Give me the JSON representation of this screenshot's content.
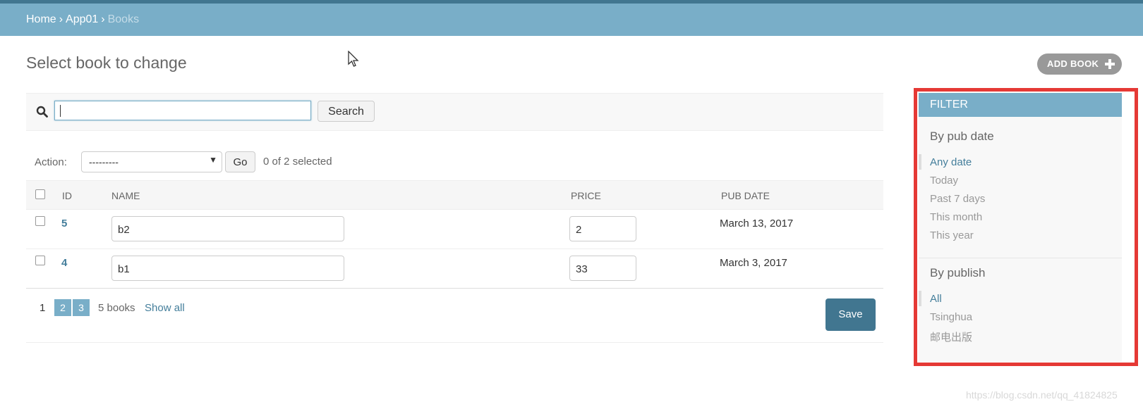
{
  "breadcrumbs": {
    "home": "Home",
    "sep": "›",
    "app": "App01",
    "current": "Books"
  },
  "page": {
    "title": "Select book to change",
    "add_button": "ADD BOOK"
  },
  "search": {
    "value": "",
    "button": "Search"
  },
  "actions": {
    "label": "Action:",
    "select_value": "---------",
    "go": "Go",
    "selected": "0 of 2 selected"
  },
  "table": {
    "headers": {
      "id": "ID",
      "name": "NAME",
      "price": "PRICE",
      "pub_date": "PUB DATE"
    },
    "rows": [
      {
        "id": "5",
        "name": "b2",
        "price": "2",
        "pub_date": "March 13, 2017"
      },
      {
        "id": "4",
        "name": "b1",
        "price": "33",
        "pub_date": "March 3, 2017"
      }
    ]
  },
  "pagination": {
    "current": "1",
    "page2": "2",
    "page3": "3",
    "count": "5 books",
    "show_all": "Show all"
  },
  "save_button": "Save",
  "filter": {
    "title": "FILTER",
    "by_pub_date": {
      "title": "By pub date",
      "options": [
        "Any date",
        "Today",
        "Past 7 days",
        "This month",
        "This year"
      ],
      "selected": "Any date"
    },
    "by_publish": {
      "title": "By publish",
      "options": [
        "All",
        "Tsinghua",
        "邮电出版"
      ],
      "selected": "All"
    }
  },
  "watermark": "https://blog.csdn.net/qq_41824825",
  "colors": {
    "header": "#79aec8",
    "topline": "#417690",
    "link": "#447e9b",
    "highlight_border": "#e53935"
  }
}
